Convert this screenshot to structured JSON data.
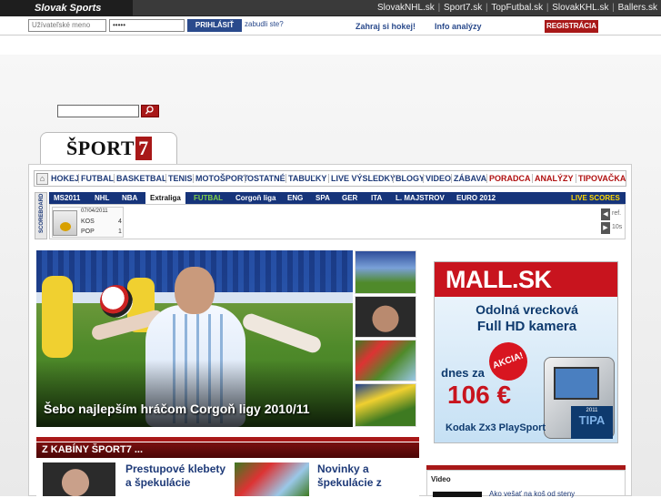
{
  "network_bar": {
    "brand": "Slovak Sports Network",
    "links": [
      "SlovakNHL.sk",
      "Sport7.sk",
      "TopFutbal.sk",
      "SlovakKHL.sk",
      "Ballers.sk"
    ]
  },
  "login": {
    "username_placeholder": "Užívateľské meno",
    "password_value": "•••••",
    "login_button": "PRIHLÁSIŤ",
    "forgot_link": "zabudli ste?",
    "play_link": "Zahraj si hokej!",
    "info_link": "Info analýzy",
    "register_button": "REGISTRÁCIA"
  },
  "search": {
    "button_icon": "search-icon"
  },
  "logo": {
    "text": "ŠPORT",
    "number": "7"
  },
  "nav": {
    "home_icon": "home-icon",
    "items": [
      "HOKEJ",
      "FUTBAL",
      "BASKETBAL",
      "TENIS",
      "MOTOŠPORT",
      "OSTATNÉ",
      "TABUĽKY",
      "LIVE VÝSLEDKY",
      "BLOGY",
      "VIDEO",
      "ZÁBAVA"
    ],
    "red_items": [
      "PORADCA",
      "ANALÝZY",
      "TIPOVAČKA"
    ]
  },
  "scoreboard": {
    "side_label": "SCOREBOARD",
    "tabs": [
      "MS2011",
      "NHL",
      "NBA",
      "Extraliga",
      "FUTBAL",
      "Corgoň liga",
      "ENG",
      "SPA",
      "GER",
      "ITA",
      "L. MAJSTROV",
      "EURO 2012"
    ],
    "active_tab": "Extraliga",
    "live_label": "LIVE SCORES",
    "match": {
      "date": "07/04/2011",
      "home_team": "KOS",
      "home_score": "4",
      "away_team": "POP",
      "away_score": "1"
    },
    "refresh_label": "ref.",
    "interval_label": "10s"
  },
  "hero": {
    "caption": "Šebo najlepším hráčom Corgoň ligy 2010/11"
  },
  "ad": {
    "brand": "MALL.SK",
    "line1": "Odolná vrecková",
    "line2": "Full HD kamera",
    "line3": "dnes za",
    "badge": "AKCIA!",
    "price": "106 €",
    "product": "Kodak Zx3 PlaySport",
    "award_year": "2011",
    "award_name": "TIPA"
  },
  "kabiny": {
    "title": "Z KABÍNY ŠPORT7 ...",
    "item1": "Prestupové klebety a špekulácie",
    "item2_line1": "Novinky a",
    "item2_line2": "špekulácie z"
  },
  "video": {
    "title": "Video",
    "link": "Ako vešať na koš od steny"
  }
}
